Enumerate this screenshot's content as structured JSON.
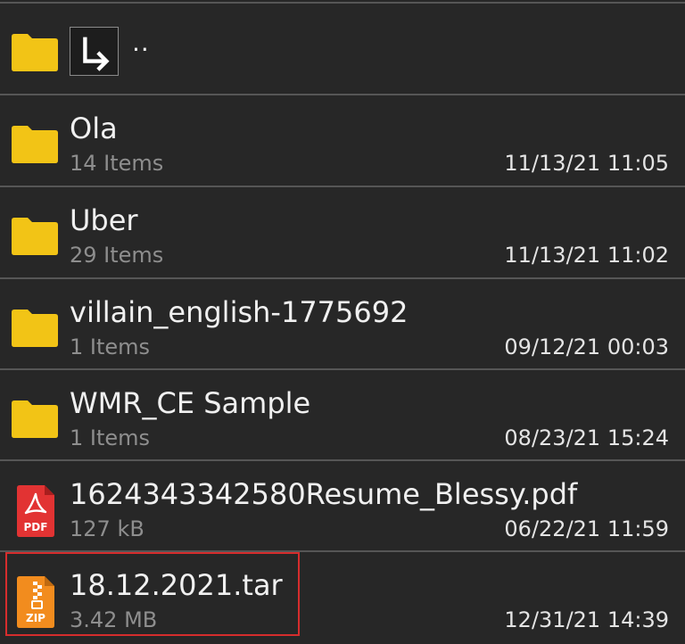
{
  "colors": {
    "background": "#272727",
    "divider": "#565656",
    "folder": "#f2c416",
    "pdf": "#e23333",
    "zip": "#f28c1e",
    "selection_outline": "#d62d2d",
    "primary_text": "#f0f0f0",
    "secondary_text": "#8e8e8e"
  },
  "parent_dir": {
    "label": "..",
    "icons": [
      "folder-icon",
      "arrow-return-icon"
    ]
  },
  "entries": [
    {
      "name": "Ola",
      "meta": "14 Items",
      "date": "11/13/21 11:05",
      "icon": "folder-icon"
    },
    {
      "name": "Uber",
      "meta": "29 Items",
      "date": "11/13/21 11:02",
      "icon": "folder-icon"
    },
    {
      "name": "villain_english-1775692",
      "meta": "1 Items",
      "date": "09/12/21 00:03",
      "icon": "folder-icon"
    },
    {
      "name": "WMR_CE Sample",
      "meta": "1 Items",
      "date": "08/23/21 15:24",
      "icon": "folder-icon"
    },
    {
      "name": "1624343342580Resume_Blessy.pdf",
      "meta": "127 kB",
      "date": "06/22/21 11:59",
      "icon": "pdf-file-icon",
      "icon_label": "PDF"
    },
    {
      "name": "18.12.2021.tar",
      "meta": "3.42 MB",
      "date": "12/31/21 14:39",
      "icon": "zip-file-icon",
      "icon_label": "ZIP",
      "selected": true
    }
  ]
}
